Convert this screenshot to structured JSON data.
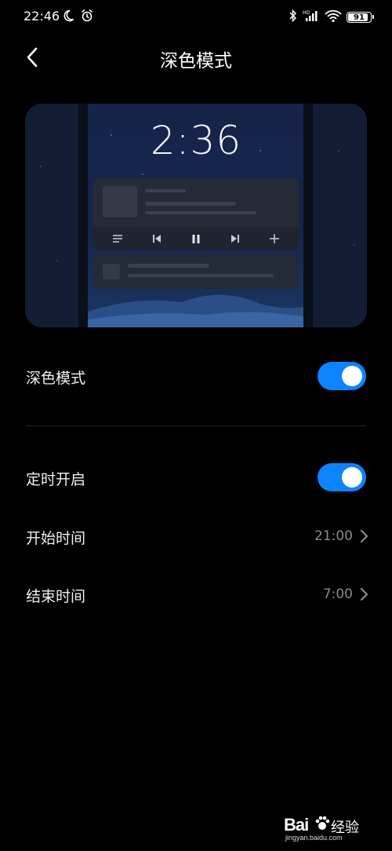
{
  "status_bar": {
    "time": "22:46",
    "battery_level": "91",
    "icons": [
      "moon-icon",
      "alarm-icon",
      "bluetooth-icon",
      "hd-icon",
      "signal-icon",
      "wifi-icon",
      "battery-icon"
    ]
  },
  "header": {
    "title": "深色模式",
    "back_icon": "back-chevron-icon"
  },
  "preview": {
    "clock": "2:36",
    "media_icons": [
      "menu-icon",
      "previous-icon",
      "pause-icon",
      "next-icon",
      "plus-icon"
    ]
  },
  "settings": {
    "dark_mode": {
      "label": "深色模式",
      "enabled": true
    },
    "scheduled": {
      "label": "定时开启",
      "enabled": true
    },
    "start_time": {
      "label": "开始时间",
      "value": "21:00"
    },
    "end_time": {
      "label": "结束时间",
      "value": "7:00"
    }
  },
  "watermark": {
    "brand": "Bai",
    "brand_suffix": "经验",
    "url": "jingyan.baidu.com"
  },
  "colors": {
    "accent": "#0d84ff",
    "background": "#000000",
    "secondary_text": "#8a8a8a"
  }
}
